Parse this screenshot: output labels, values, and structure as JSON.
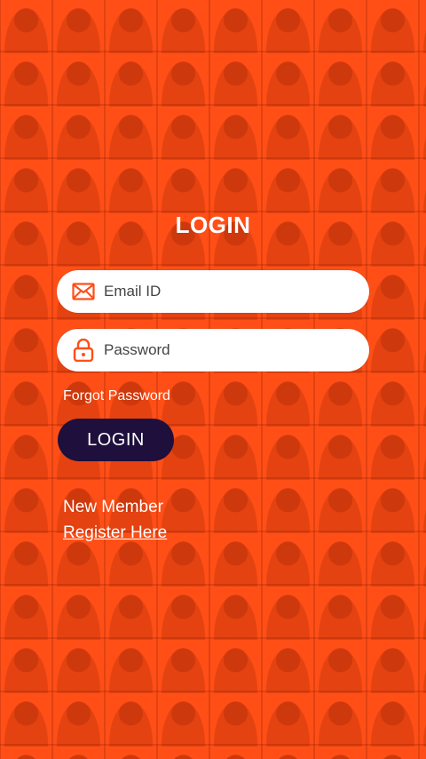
{
  "colors": {
    "background": "#ff4f17",
    "accent": "#ff4f17",
    "button": "#1e0f3c",
    "text": "#ffffff"
  },
  "login": {
    "title": "LOGIN",
    "email": {
      "placeholder": "Email ID",
      "value": "",
      "icon": "envelope-icon"
    },
    "password": {
      "placeholder": "Password",
      "value": "",
      "icon": "lock-icon"
    },
    "forgot_label": "Forgot Password",
    "login_button": "LOGIN",
    "new_member_label": "New Member",
    "register_label": "Register Here"
  }
}
